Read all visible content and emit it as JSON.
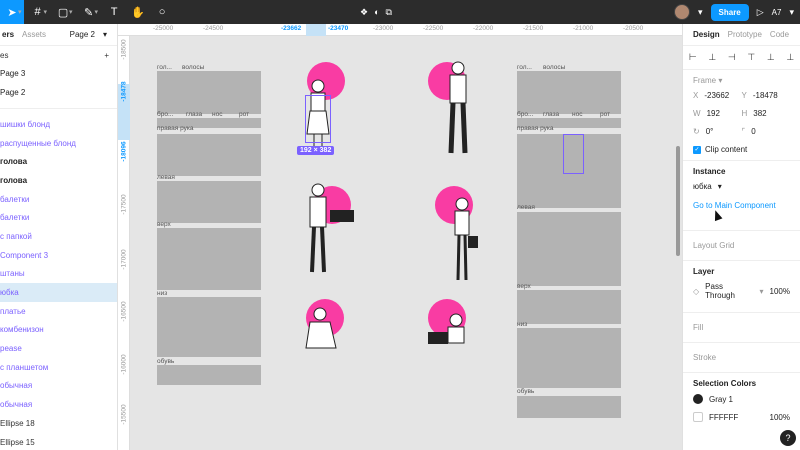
{
  "toolbar": {
    "share_label": "Share",
    "zoom_label": "A7",
    "move_icon": "move-icon",
    "frame_icon": "frame-icon",
    "shape_icon": "rectangle-icon",
    "pen_icon": "pen-icon",
    "text_icon": "text-icon",
    "hand_icon": "hand-icon",
    "comment_icon": "comment-icon"
  },
  "left_panel": {
    "tab_layers": "ers",
    "tab_assets": "Assets",
    "page_selector": "Page 2",
    "pages_header": "es",
    "pages": [
      "Page 3",
      "Page 2"
    ],
    "layers": [
      {
        "label": "шишки блонд",
        "style": "component"
      },
      {
        "label": "распущенные блонд",
        "style": "component"
      },
      {
        "label": "голова",
        "style": "bold"
      },
      {
        "label": "голова",
        "style": "bold"
      },
      {
        "label": "балетки",
        "style": "component"
      },
      {
        "label": "балетки",
        "style": "component"
      },
      {
        "label": "с папкой",
        "style": "component"
      },
      {
        "label": "Component 3",
        "style": "component"
      },
      {
        "label": "штаны",
        "style": "component"
      },
      {
        "label": "юбка",
        "style": "selected"
      },
      {
        "label": "платье",
        "style": "component"
      },
      {
        "label": "комбенизон",
        "style": "component"
      },
      {
        "label": "pease",
        "style": "component"
      },
      {
        "label": "с планшетом",
        "style": "component"
      },
      {
        "label": "обычная",
        "style": "component"
      },
      {
        "label": "обычная",
        "style": "component"
      },
      {
        "label": "Ellipse 18",
        "style": "plain"
      },
      {
        "label": "Ellipse 15",
        "style": "plain"
      }
    ]
  },
  "ruler": {
    "top": [
      "-25000",
      "-24500",
      "-23662",
      "-23470",
      "-23000",
      "-22500",
      "-22000",
      "-21500",
      "-21000",
      "-20500"
    ],
    "left": [
      "-18500",
      "-18478",
      "-18096",
      "-17500",
      "-17000",
      "-16500",
      "-16000",
      "-15500"
    ]
  },
  "canvas": {
    "labels": {
      "left_head": "гол...",
      "left_hair": "волосы",
      "left_brows": "бро...",
      "left_eyes": "глаза",
      "left_nose": "нос",
      "left_mouth": "рот",
      "left_right_hand": "правая рука",
      "left_left_hand": "левая",
      "left_top": "верх",
      "left_bottom": "низ",
      "left_shoes": "обувь",
      "right_head": "гол...",
      "right_hair": "волосы",
      "right_brows": "бро...",
      "right_eyes": "глаза",
      "right_nose": "нос",
      "right_mouth": "рот",
      "right_right_hand": "правая рука",
      "right_left_hand": "левая",
      "right_top": "верх",
      "right_bottom": "низ",
      "right_shoes": "обувь"
    },
    "selection_size": "192 × 382"
  },
  "right_panel": {
    "tab_design": "Design",
    "tab_prototype": "Prototype",
    "tab_code": "Code",
    "frame_label": "Frame",
    "x_label": "X",
    "x_value": "-23662",
    "y_label": "Y",
    "y_value": "-18478",
    "w_label": "W",
    "w_value": "192",
    "h_label": "H",
    "h_value": "382",
    "rotation_value": "0°",
    "radius_value": "0",
    "clip_content": "Clip content",
    "instance_title": "Instance",
    "instance_value": "юбка",
    "main_component_link": "Go to Main Component",
    "layout_grid": "Layout Grid",
    "layer_title": "Layer",
    "blend_mode": "Pass Through",
    "opacity": "100%",
    "fill_title": "Fill",
    "stroke_title": "Stroke",
    "selection_colors_title": "Selection Colors",
    "colors": [
      {
        "name": "Gray 1",
        "hex": "#222222",
        "opacity": ""
      },
      {
        "name": "FFFFFF",
        "hex": "#FFFFFF",
        "opacity": "100%"
      }
    ]
  },
  "colors": {
    "accent": "#0d99ff",
    "selection": "#7b61ff",
    "pink": "#f93ca3",
    "toolbar": "#2c2c2c"
  }
}
